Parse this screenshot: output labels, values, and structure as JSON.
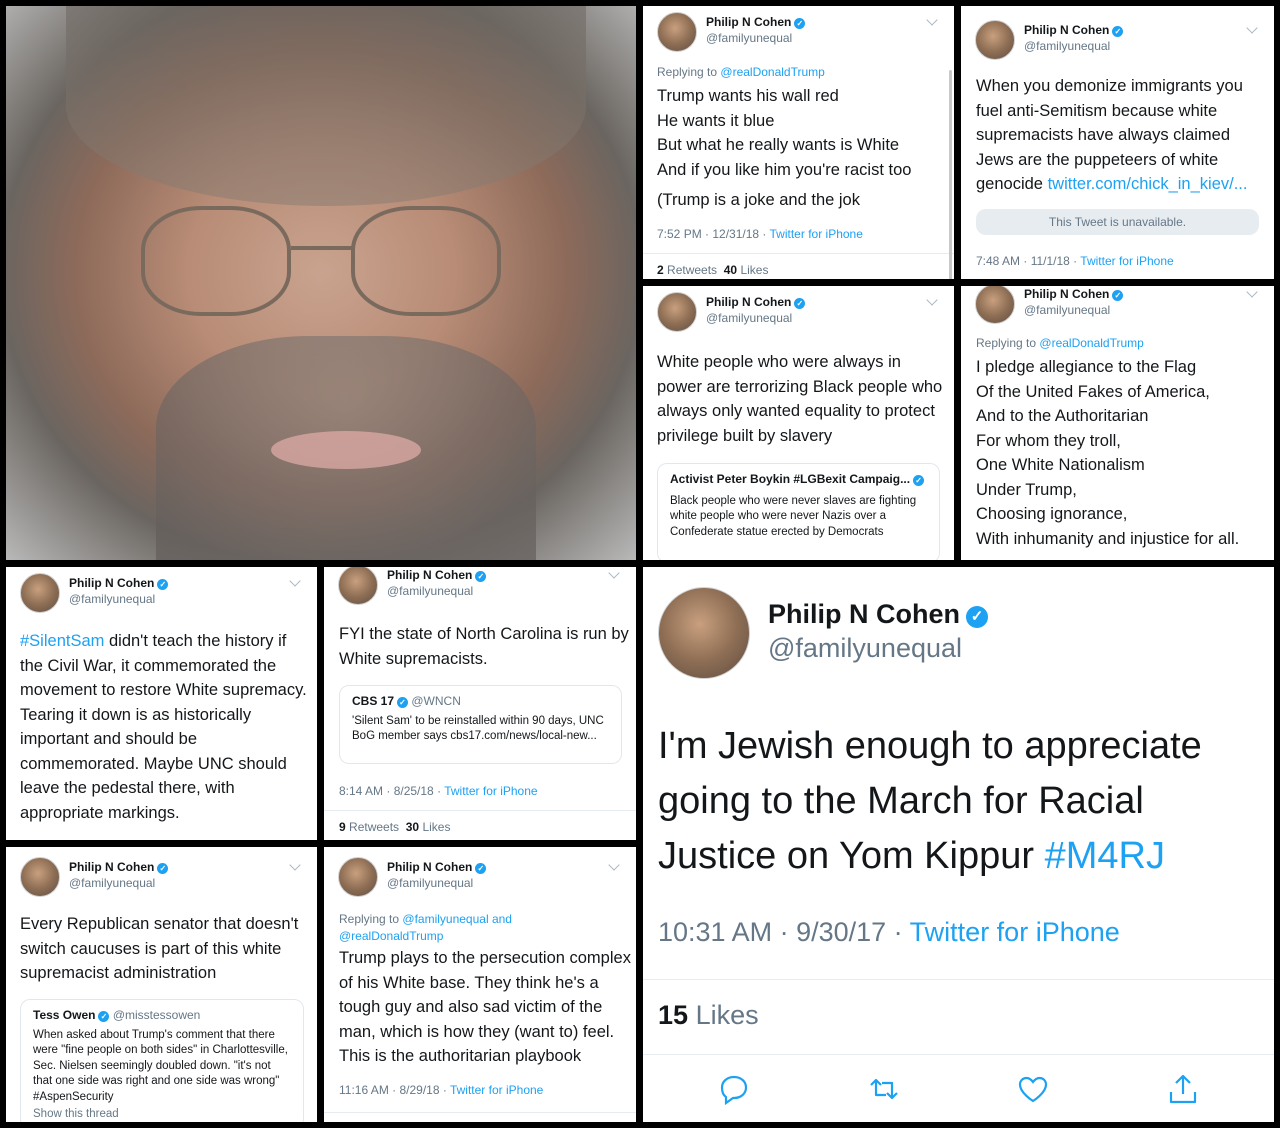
{
  "photo_alt": "Portrait photo",
  "profile": {
    "name": "Philip N Cohen",
    "handle": "@familyunequal"
  },
  "tweets": {
    "t1": {
      "reply_prefix": "Replying to",
      "reply_to": "@realDonaldTrump",
      "lines": [
        "Trump wants his wall red",
        "He wants it blue",
        "But what he really wants is White",
        "And if you like him you're racist too",
        "(Trump is a joke and the jok"
      ],
      "time": "7:52 PM · 12/31/18 · ",
      "source": "Twitter for iPhone",
      "retweets": "2",
      "retweets_label": "Retweets",
      "likes": "40",
      "likes_label": "Likes"
    },
    "t2": {
      "text": "When you demonize immigrants you fuel anti-Semitism because white supremacists have always claimed Jews are the puppeteers of white genocide ",
      "link": "twitter.com/chick_in_kiev/...",
      "unavailable": "This Tweet is unavailable.",
      "time": "7:48 AM · 11/1/18 · ",
      "source": "Twitter for iPhone"
    },
    "t3": {
      "text": "White people who were always in power are terrorizing Black people who always only wanted equality to protect privilege built by slavery",
      "quote_name": "Activist Peter Boykin #LGBexit Campaig...",
      "quote_text": "Black people who were never slaves are fighting white people who were never Nazis over a Confederate statue erected by Democrats"
    },
    "t4": {
      "reply_prefix": "Replying to",
      "reply_to": "@realDonaldTrump",
      "lines": [
        "I pledge allegiance to the Flag",
        "Of the United Fakes of America,",
        "And to the Authoritarian",
        "For whom they troll,",
        "One White Nationalism",
        "Under Trump,",
        "Choosing ignorance,",
        "With inhumanity and injustice for all."
      ]
    },
    "t5": {
      "hashtag": "#SilentSam",
      "text": " didn't teach the history if the Civil War, it commemorated the movement to restore White supremacy. Tearing it down is as historically important and should be commemorated. Maybe UNC should leave the pedestal there, with appropriate markings."
    },
    "t6": {
      "text": "FYI the state of North Carolina is run by White supremacists.",
      "quote_name": "CBS 17",
      "quote_handle": "@WNCN",
      "quote_text": "'Silent Sam' to be reinstalled within 90 days, UNC BoG member says cbs17.com/news/local-new...",
      "time": "8:14 AM · 8/25/18 · ",
      "source": "Twitter for iPhone",
      "retweets": "9",
      "retweets_label": "Retweets",
      "likes": "30",
      "likes_label": "Likes"
    },
    "t7": {
      "text": "Every Republican senator that doesn't switch caucuses is part of this white supremacist administration",
      "quote_name": "Tess Owen",
      "quote_handle": "@misstessowen",
      "quote_text": "When asked about Trump's comment that there were \"fine people on both sides\" in Charlottesville, Sec. Nielsen seemingly doubled down. \"it's not that one side was right and one side was wrong\" #AspenSecurity",
      "quote_more": "Show this thread"
    },
    "t8": {
      "reply_prefix": "Replying to",
      "reply_to_1": "@familyunequal",
      "reply_and": " and",
      "reply_to_2": "@realDonaldTrump",
      "text": "Trump plays to the persecution complex of his White base. They think he's a tough guy and also sad victim of the man, which is how they (want to) feel. This is the authoritarian playbook",
      "time": "11:16 AM · 8/29/18 · ",
      "source": "Twitter for iPhone"
    },
    "t9": {
      "text": "I'm Jewish enough to appreciate going to the March for Racial Justice on Yom Kippur ",
      "hashtag": "#M4RJ",
      "time": "10:31 AM · 9/30/17 · ",
      "source": "Twitter for iPhone",
      "likes": "15",
      "likes_label": "Likes"
    }
  },
  "icons": {
    "reply": "reply-icon",
    "retweet": "retweet-icon",
    "like": "like-icon",
    "share": "share-icon"
  },
  "colors": {
    "link": "#1da1f2",
    "muted": "#657786",
    "border": "#e1e8ed"
  }
}
